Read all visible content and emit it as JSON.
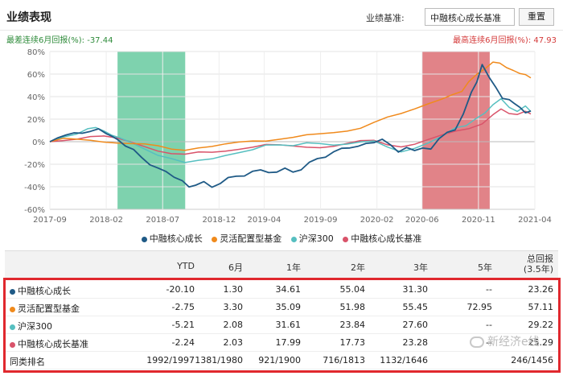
{
  "header": {
    "title": "业绩表现",
    "benchmark_label": "业绩基准:",
    "benchmark_selected": "中融核心成长基准",
    "reset_label": "重置"
  },
  "drawdown": {
    "min_label": "最差连续6月回报(%): -37.44",
    "max_label": "最高连续6月回报(%): 47.93"
  },
  "colors": {
    "fund": "#1f5a86",
    "peer": "#f08a1c",
    "csi300": "#56bfc0",
    "benchmark": "#d9536a",
    "green_band": "#5ec79a",
    "red_band": "#d9646a"
  },
  "chart_data": {
    "type": "line",
    "x_ticks": [
      "2017-09",
      "2018-02",
      "2018-07",
      "2018-12",
      "2019-04",
      "2019-09",
      "2020-02",
      "2020-06",
      "2020-11",
      "2021-04"
    ],
    "y_ticks": [
      "80%",
      "60%",
      "40%",
      "20%",
      "0%",
      "-20%",
      "-40%",
      "-60%"
    ],
    "ylim": [
      -60,
      80
    ],
    "grid": true,
    "shaded": [
      {
        "kind": "worst-6m",
        "from": "2018-03",
        "to": "2018-09"
      },
      {
        "kind": "best-6m",
        "from": "2020-06",
        "to": "2020-12"
      }
    ],
    "series": [
      {
        "name": "中融核心成长",
        "color": "#1f5a86",
        "values": [
          [
            0,
            0
          ],
          [
            0.6,
            4
          ],
          [
            1.2,
            5
          ],
          [
            1.8,
            8
          ],
          [
            2.4,
            9
          ],
          [
            3,
            8
          ],
          [
            3.6,
            10
          ],
          [
            4.2,
            9
          ],
          [
            4.6,
            4
          ],
          [
            5,
            3
          ],
          [
            5.6,
            -3
          ],
          [
            6.2,
            -8
          ],
          [
            6.8,
            -14
          ],
          [
            7.4,
            -20
          ],
          [
            8,
            -24
          ],
          [
            8.6,
            -26
          ],
          [
            9.2,
            -31
          ],
          [
            9.8,
            -36
          ],
          [
            10.3,
            -40
          ],
          [
            10.8,
            -38
          ],
          [
            11.4,
            -36
          ],
          [
            12,
            -40
          ],
          [
            12.6,
            -37
          ],
          [
            13.2,
            -33
          ],
          [
            13.8,
            -30
          ],
          [
            14.4,
            -29
          ],
          [
            15,
            -28
          ],
          [
            15.6,
            -26
          ],
          [
            16.2,
            -25
          ],
          [
            16.8,
            -27
          ],
          [
            17.4,
            -26
          ],
          [
            18,
            -26
          ],
          [
            18.6,
            -23
          ],
          [
            19.2,
            -20
          ],
          [
            19.8,
            -16
          ],
          [
            20.4,
            -12
          ],
          [
            21,
            -9
          ],
          [
            21.6,
            -7
          ],
          [
            22.2,
            -5
          ],
          [
            22.8,
            -4
          ],
          [
            23.4,
            -2
          ],
          [
            24,
            0
          ],
          [
            24.6,
            2
          ],
          [
            25.2,
            -4
          ],
          [
            25.8,
            -8
          ],
          [
            26.4,
            -4
          ],
          [
            27,
            -10
          ],
          [
            27.6,
            -6
          ],
          [
            28.2,
            -4
          ],
          [
            28.8,
            2
          ],
          [
            29.4,
            6
          ],
          [
            30,
            12
          ],
          [
            30.6,
            26
          ],
          [
            31.2,
            42
          ],
          [
            31.6,
            55
          ],
          [
            32,
            68
          ],
          [
            32.5,
            60
          ],
          [
            33,
            48
          ],
          [
            33.5,
            40
          ],
          [
            34,
            38
          ],
          [
            34.4,
            35
          ],
          [
            34.8,
            30
          ],
          [
            35.2,
            26
          ],
          [
            35.6,
            25
          ]
        ]
      },
      {
        "name": "灵活配置型基金",
        "color": "#f08a1c",
        "values": [
          [
            0,
            0
          ],
          [
            1,
            1
          ],
          [
            2,
            2
          ],
          [
            3,
            3
          ],
          [
            4,
            2
          ],
          [
            5,
            0
          ],
          [
            6,
            -2
          ],
          [
            7,
            -3
          ],
          [
            8,
            -4
          ],
          [
            9,
            -6
          ],
          [
            10,
            -7
          ],
          [
            11,
            -6
          ],
          [
            12,
            -6
          ],
          [
            13,
            -4
          ],
          [
            14,
            -1
          ],
          [
            15,
            2
          ],
          [
            16,
            3
          ],
          [
            17,
            4
          ],
          [
            18,
            4
          ],
          [
            19,
            5
          ],
          [
            20,
            6
          ],
          [
            21,
            8
          ],
          [
            22,
            10
          ],
          [
            23,
            12
          ],
          [
            24,
            16
          ],
          [
            25,
            20
          ],
          [
            26,
            24
          ],
          [
            27,
            30
          ],
          [
            28,
            36
          ],
          [
            29,
            40
          ],
          [
            29.8,
            43
          ],
          [
            30.5,
            46
          ],
          [
            31,
            52
          ],
          [
            31.6,
            60
          ],
          [
            32.2,
            65
          ],
          [
            32.8,
            70
          ],
          [
            33.3,
            72
          ],
          [
            33.8,
            66
          ],
          [
            34.3,
            64
          ],
          [
            34.8,
            62
          ],
          [
            35.2,
            60
          ],
          [
            35.6,
            57
          ]
        ]
      },
      {
        "name": "沪深300",
        "color": "#56bfc0",
        "values": [
          [
            0,
            0
          ],
          [
            1,
            5
          ],
          [
            2,
            9
          ],
          [
            2.8,
            12
          ],
          [
            3.4,
            12
          ],
          [
            4,
            10
          ],
          [
            4.6,
            6
          ],
          [
            5.2,
            2
          ],
          [
            6,
            -3
          ],
          [
            7,
            -8
          ],
          [
            8,
            -12
          ],
          [
            9,
            -14
          ],
          [
            10,
            -18
          ],
          [
            11,
            -17
          ],
          [
            12,
            -16
          ],
          [
            13,
            -12
          ],
          [
            14,
            -8
          ],
          [
            15,
            -5
          ],
          [
            16,
            -2
          ],
          [
            17,
            -4
          ],
          [
            18,
            -6
          ],
          [
            19,
            -3
          ],
          [
            20,
            -2
          ],
          [
            21,
            -2
          ],
          [
            22,
            -1
          ],
          [
            23,
            0
          ],
          [
            24,
            0
          ],
          [
            25,
            -5
          ],
          [
            26,
            -8
          ],
          [
            27,
            -4
          ],
          [
            28,
            0
          ],
          [
            29,
            4
          ],
          [
            30,
            10
          ],
          [
            30.8,
            14
          ],
          [
            31.5,
            20
          ],
          [
            32.2,
            28
          ],
          [
            32.8,
            32
          ],
          [
            33.4,
            36
          ],
          [
            34,
            32
          ],
          [
            34.6,
            28
          ],
          [
            35.2,
            30
          ],
          [
            35.6,
            29
          ]
        ]
      },
      {
        "name": "中融核心成长基准",
        "color": "#d9536a",
        "values": [
          [
            0,
            0
          ],
          [
            1,
            2
          ],
          [
            2,
            3
          ],
          [
            3,
            4
          ],
          [
            4,
            3
          ],
          [
            5,
            1
          ],
          [
            6,
            -1
          ],
          [
            7,
            -3
          ],
          [
            8,
            -6
          ],
          [
            9,
            -9
          ],
          [
            10,
            -11
          ],
          [
            11,
            -10
          ],
          [
            12,
            -10
          ],
          [
            13,
            -8
          ],
          [
            14,
            -6
          ],
          [
            15,
            -5
          ],
          [
            16,
            -4
          ],
          [
            17,
            -5
          ],
          [
            18,
            -5
          ],
          [
            19,
            -4
          ],
          [
            20,
            -3
          ],
          [
            21,
            -2
          ],
          [
            22,
            -1
          ],
          [
            23,
            0
          ],
          [
            24,
            0
          ],
          [
            25,
            -3
          ],
          [
            26,
            -4
          ],
          [
            27,
            -2
          ],
          [
            28,
            1
          ],
          [
            29,
            4
          ],
          [
            30,
            8
          ],
          [
            31,
            12
          ],
          [
            32,
            18
          ],
          [
            32.8,
            24
          ],
          [
            33.4,
            28
          ],
          [
            34,
            26
          ],
          [
            34.6,
            25
          ],
          [
            35.2,
            25
          ],
          [
            35.6,
            25
          ]
        ]
      }
    ]
  },
  "legend": [
    {
      "name": "中融核心成长",
      "color": "#1f5a86"
    },
    {
      "name": "灵活配置型基金",
      "color": "#f08a1c"
    },
    {
      "name": "沪深300",
      "color": "#56bfc0"
    },
    {
      "name": "中融核心成长基准",
      "color": "#d9536a"
    }
  ],
  "table": {
    "headers": {
      "ytd": "YTD",
      "m6": "6月",
      "y1": "1年",
      "y2": "2年",
      "y3": "3年",
      "y5": "5年",
      "total_line1": "总回报",
      "total_line2": "(3.5年)"
    },
    "rows": [
      {
        "name": "中融核心成长",
        "color": "#1f5a86",
        "ytd": "-20.10",
        "m6": "1.30",
        "y1": "34.61",
        "y2": "55.04",
        "y3": "31.30",
        "y5": "--",
        "total": "23.26"
      },
      {
        "name": "灵活配置型基金",
        "color": "#f08a1c",
        "ytd": "-2.75",
        "m6": "3.30",
        "y1": "35.09",
        "y2": "51.98",
        "y3": "55.45",
        "y5": "72.95",
        "total": "57.11"
      },
      {
        "name": "沪深300",
        "color": "#56bfc0",
        "ytd": "-5.21",
        "m6": "2.08",
        "y1": "31.61",
        "y2": "23.84",
        "y3": "27.60",
        "y5": "--",
        "total": "29.22"
      },
      {
        "name": "中融核心成长基准",
        "color": "#d9536a",
        "ytd": "-2.24",
        "m6": "2.03",
        "y1": "17.99",
        "y2": "17.73",
        "y3": "23.28",
        "y5": "--",
        "total": "25.29"
      },
      {
        "name": "同类排名",
        "color": "",
        "ytd": "1992/1997",
        "m6": "1381/1980",
        "y1": "921/1900",
        "y2": "716/1813",
        "y3": "1132/1646",
        "y5": "",
        "total": "246/1456"
      }
    ]
  },
  "watermark": "新经济e线"
}
